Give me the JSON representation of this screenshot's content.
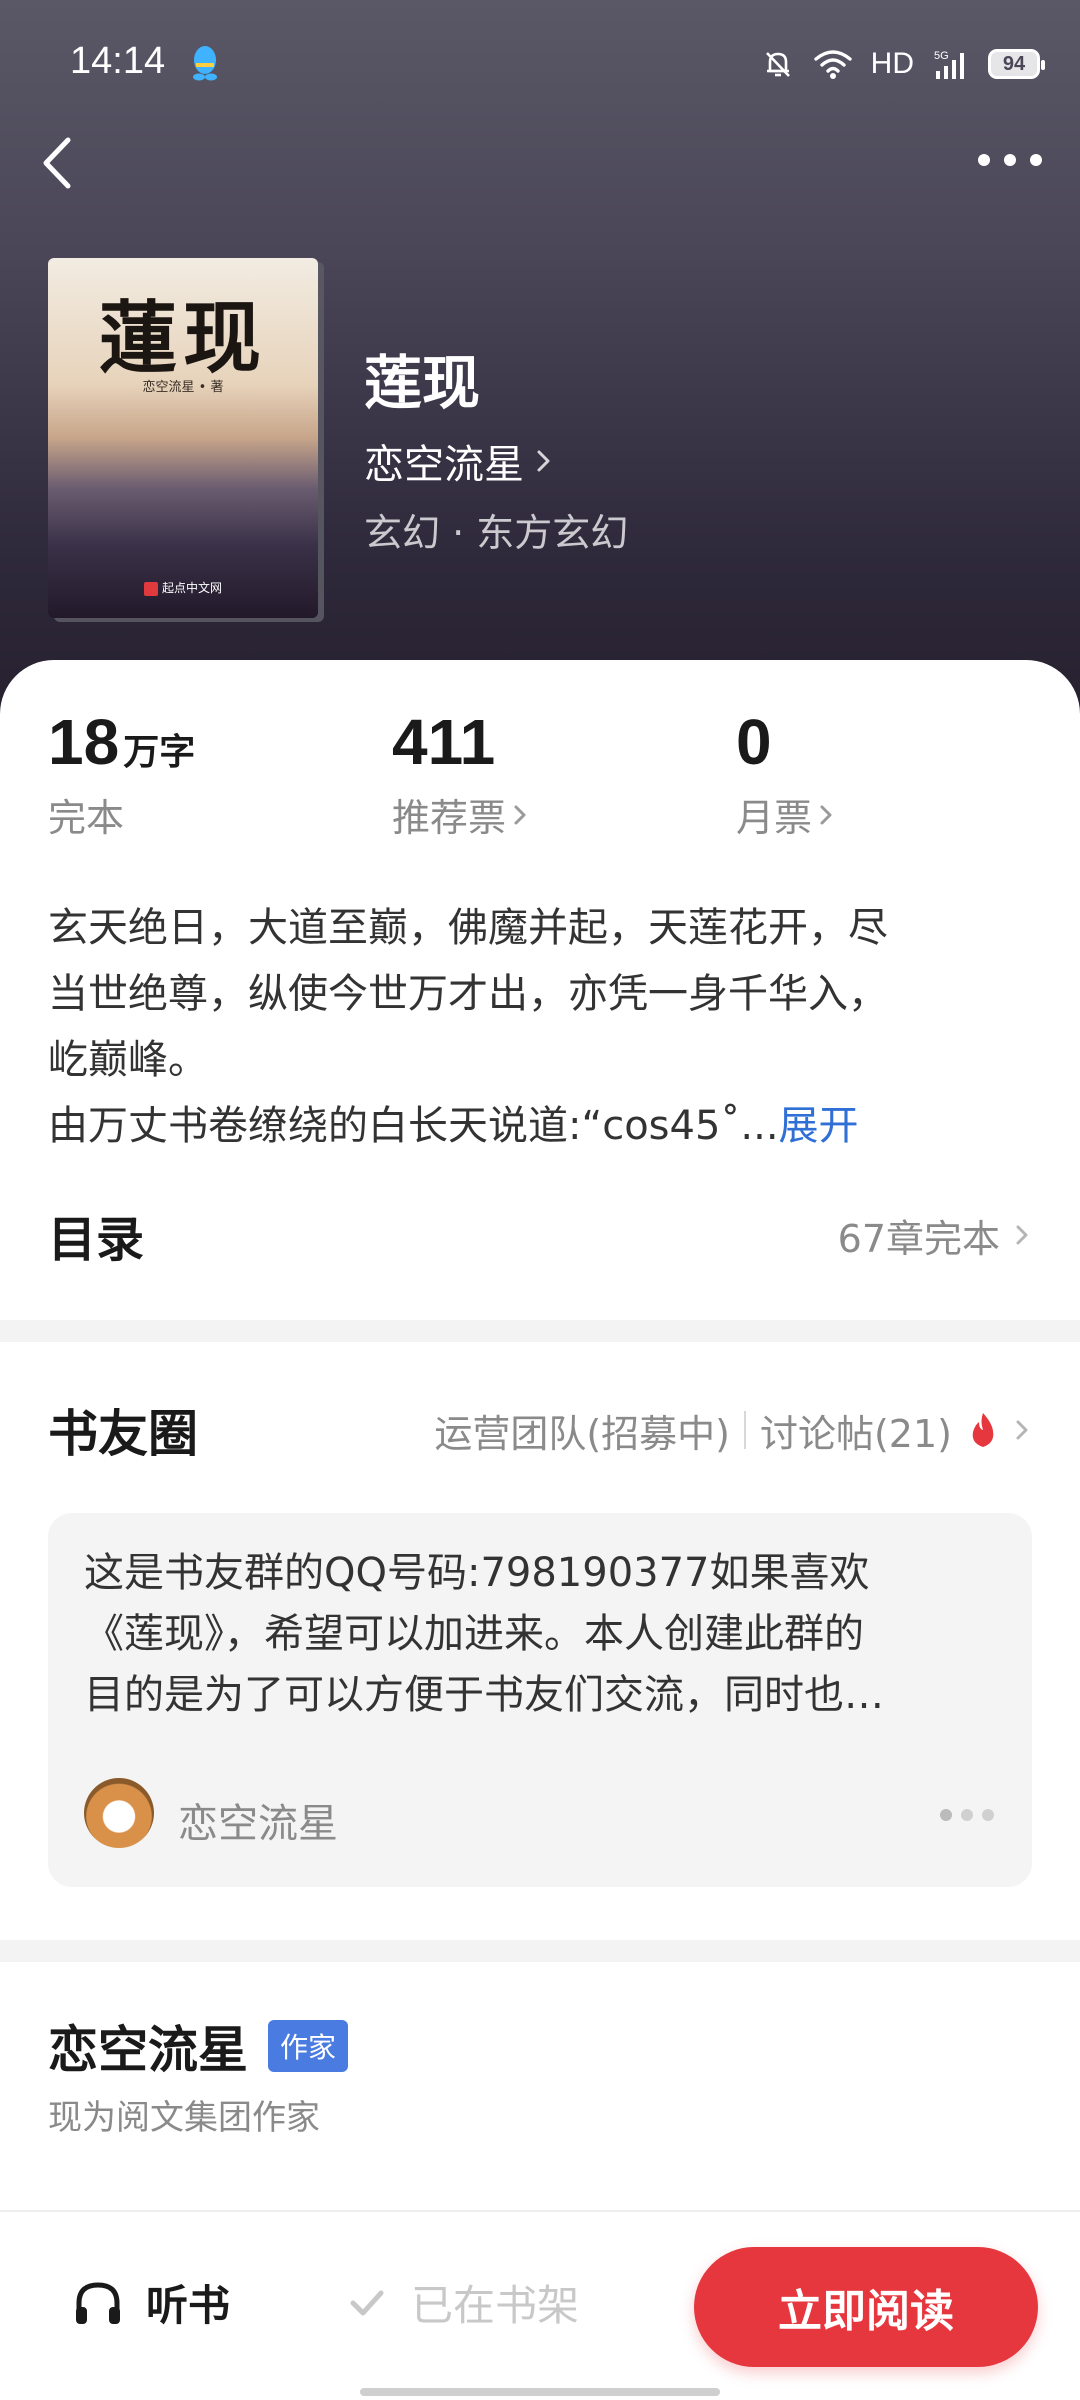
{
  "status_bar": {
    "time": "14:14",
    "hd": "HD",
    "network": "5G",
    "battery": "94"
  },
  "book": {
    "cover_title": "蓮现",
    "cover_author": "恋空流星 • 著",
    "cover_publisher": "起点中文网",
    "title": "莲现",
    "author": "恋空流星",
    "genre": "玄幻 · 东方玄幻"
  },
  "stats": [
    {
      "value": "18",
      "unit": "万字",
      "label": "完本"
    },
    {
      "value": "411",
      "label": "推荐票"
    },
    {
      "value": "0",
      "label": "月票"
    }
  ],
  "description": {
    "lines": [
      "玄天绝日，大道至巅，佛魔并起，天莲花开，尽",
      "当世绝尊，纵使今世万才出，亦凭一身千华入，",
      "屹巅峰。",
      "由万丈书卷缭绕的白长天说道:“cos45˚..."
    ],
    "expand": "展开"
  },
  "toc": {
    "title": "目录",
    "status": "67章完本"
  },
  "circle": {
    "title": "书友圈",
    "team": "运营团队(招募中)",
    "posts": "讨论帖(21)",
    "post": {
      "lines": [
        "这是书友群的QQ号码:798190377如果喜欢",
        "《莲现》，希望可以加进来。本人创建此群的",
        "目的是为了可以方便于书友们交流，同时也…"
      ],
      "user": "恋空流星"
    }
  },
  "author_section": {
    "name": "恋空流星",
    "badge": "作家",
    "desc": "现为阅文集团作家"
  },
  "bottom_bar": {
    "listen": "听书",
    "shelf": "已在书架",
    "read": "立即阅读"
  },
  "colors": {
    "accent": "#e6363e",
    "link": "#2f6fd6",
    "badge": "#4a7be0",
    "hot": "#e6363e"
  }
}
